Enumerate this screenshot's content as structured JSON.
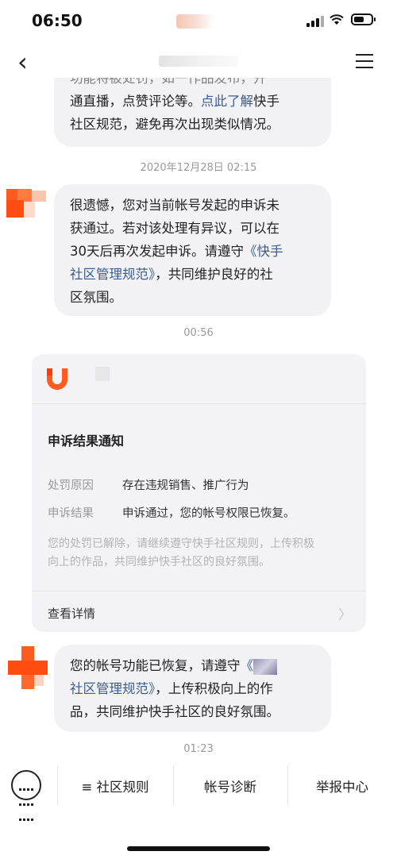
{
  "status": {
    "time": "06:50"
  },
  "nav": {
    "back_glyph": "‹",
    "menu_icon": "hamburger-menu-icon"
  },
  "messages": [
    {
      "lines": [
        "功能将被处罚，如…作品发布，开",
        "通直播，点赞评论等。",
        "点此了解",
        "快手",
        "社区规范，避免再次出现类似情况。"
      ]
    },
    {
      "timestamp": "2020年12月28日 02:15"
    },
    {
      "text1": "很遗憾，您对当前帐号发起的申诉未",
      "text2": "获通过。若对该处理有异议，可以在",
      "text3": "30天后再次发起申诉。请遵守",
      "link1": "《快手",
      "link2": "社区管理规范》",
      "text4": "，共同维护良好的社",
      "text5": "区氛围。"
    },
    {
      "timestamp": "00:56"
    }
  ],
  "msg_top": {
    "l1": "功能将被处罚，如一作品发布，开",
    "l2a": "通直播，点赞评论等。",
    "l2link": "点此了解",
    "l2b": "快手",
    "l3": "社区规范，避免再次出现类似情况。"
  },
  "ts1": "2020年12月28日 02:15",
  "msg_reject": {
    "l1": "很遗憾，您对当前帐号发起的申诉未",
    "l2": "获通过。若对该处理有异议，可以在",
    "l3a": "30天后再次发起申诉。请遵守",
    "l3link": "《快手",
    "l4link": "社区管理规范》",
    "l4b": "，共同维护良好的社",
    "l5": "区氛围。"
  },
  "ts2": "00:56",
  "card": {
    "title": "申诉结果通知",
    "row1_label": "处罚原因",
    "row1_value": "存在违规销售、推广行为",
    "row2_label": "申诉结果",
    "row2_value": "申诉通过，您的帐号权限已恢复。",
    "note1": "您的处罚已解除，请继续遵守快手社区规则，上传积极",
    "note2": "向上的作品，共同维护快手社区的良好氛围。",
    "details": "查看详情",
    "chevron": "〉"
  },
  "msg_restored": {
    "l1a": "您的帐号功能已恢复，请遵守",
    "l1link": "《",
    "l2link": "社区管理规范》",
    "l2b": "，上传积极向上的作",
    "l3": "品，共同维护快手社区的良好氛围。"
  },
  "ts3": "01:23",
  "bottom": {
    "item1": "≡ 社区规则",
    "item2": "帐号诊断",
    "item3": "举报中心"
  },
  "colors": {
    "accent": "#ff5a1f",
    "link": "#3b5c8e",
    "bubble": "#f2f2f4"
  }
}
